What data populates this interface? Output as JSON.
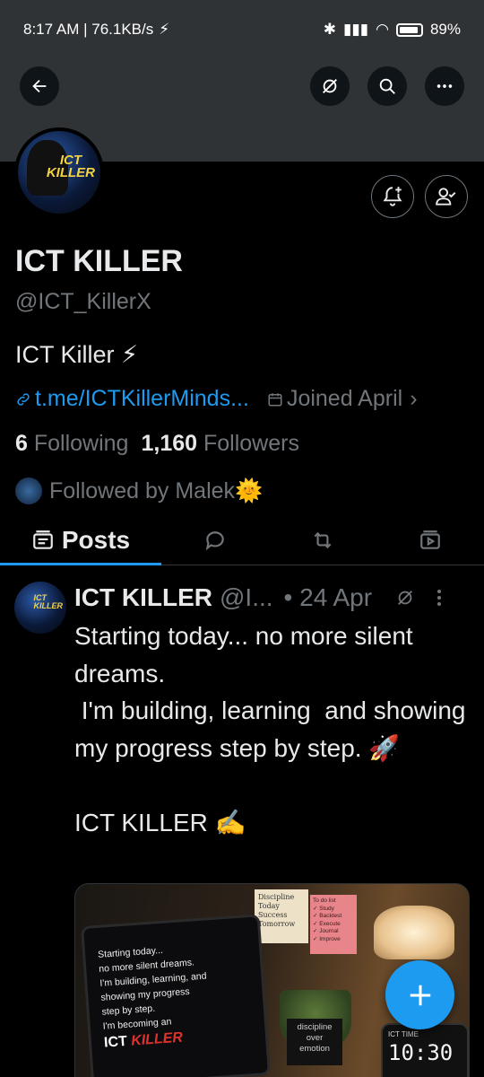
{
  "status_bar": {
    "time_speed": "8:17 AM | 76.1KB/s",
    "battery": "89%"
  },
  "profile": {
    "name": "ICT KILLER",
    "handle": "@ICT_KillerX",
    "bio": "ICT Killer ⚡",
    "link": "t.me/ICTKillerMinds...",
    "joined": "Joined April",
    "following_count": "6",
    "following_label": "Following",
    "followers_count": "1,160",
    "followers_label": "Followers",
    "followed_by": "Followed by Malek🌞",
    "avatar_text": "ICT KILLER"
  },
  "tabs": [
    {
      "label": "Posts",
      "icon": "posts-icon",
      "active": true
    },
    {
      "label": "",
      "icon": "reply-icon",
      "active": false
    },
    {
      "label": "",
      "icon": "repost-icon",
      "active": false
    },
    {
      "label": "",
      "icon": "media-icon",
      "active": false
    }
  ],
  "post": {
    "author": "ICT KILLER",
    "handle": "@I...",
    "date": "• 24 Apr",
    "text_lines": [
      "Starting today... no more silent dreams.",
      " I'm building, learning  and showing my progress step by step. 🚀",
      "",
      "ICT KILLER ✍️"
    ],
    "media": {
      "laptop_lines": [
        "Starting today...",
        "no more silent dreams.",
        "I'm building, learning, and",
        "showing my progress",
        "step by step.",
        "I'm becoming an"
      ],
      "laptop_brand_1": "ICT",
      "laptop_brand_2": "KILLER",
      "note_lines": [
        "Discipline",
        "Today",
        "Success",
        "Tomorrow"
      ],
      "todo_title": "To do list",
      "todo_items": [
        "✓ Study",
        "✓ Backtest",
        "✓ Execute",
        "✓ Journal",
        "✓ Improve"
      ],
      "sign_lines": [
        "discipline",
        "over",
        "emotion"
      ],
      "clock_label": "ICT TIME",
      "clock_time": "10:30"
    }
  },
  "colors": {
    "accent": "#1d9bf0",
    "background": "#000000",
    "muted": "#71767b"
  }
}
